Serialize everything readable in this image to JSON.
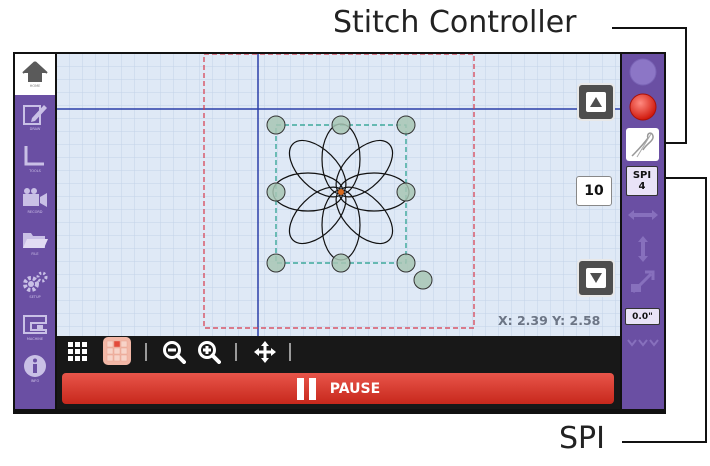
{
  "callouts": {
    "stitch_controller": "Stitch Controller",
    "spi": "SPI"
  },
  "sidebar_left": {
    "items": [
      {
        "icon": "home-icon",
        "caption": "HOME"
      },
      {
        "icon": "pencil-icon",
        "caption": "DRAW"
      },
      {
        "icon": "ruler-icon",
        "caption": "TOOLS"
      },
      {
        "icon": "camera-icon",
        "caption": "RECORD"
      },
      {
        "icon": "folder-icon",
        "caption": "FILE"
      },
      {
        "icon": "gear-icon",
        "caption": "SETUP"
      },
      {
        "icon": "sewing-machine-icon",
        "caption": "MACHINE"
      },
      {
        "icon": "info-icon",
        "caption": "INFO"
      }
    ]
  },
  "canvas": {
    "coords_text": "X: 2.39 Y: 2.58"
  },
  "controls": {
    "spi_value": "10"
  },
  "sidebar_right": {
    "spi_label": "SPI",
    "spi_value": "4",
    "offset_value": "0.0\""
  },
  "pause": {
    "label": "PAUSE"
  },
  "colors": {
    "accent_purple": "#6a4fa3",
    "pause_red": "#d83a2e",
    "canvas_bg": "#dfe9f6"
  }
}
